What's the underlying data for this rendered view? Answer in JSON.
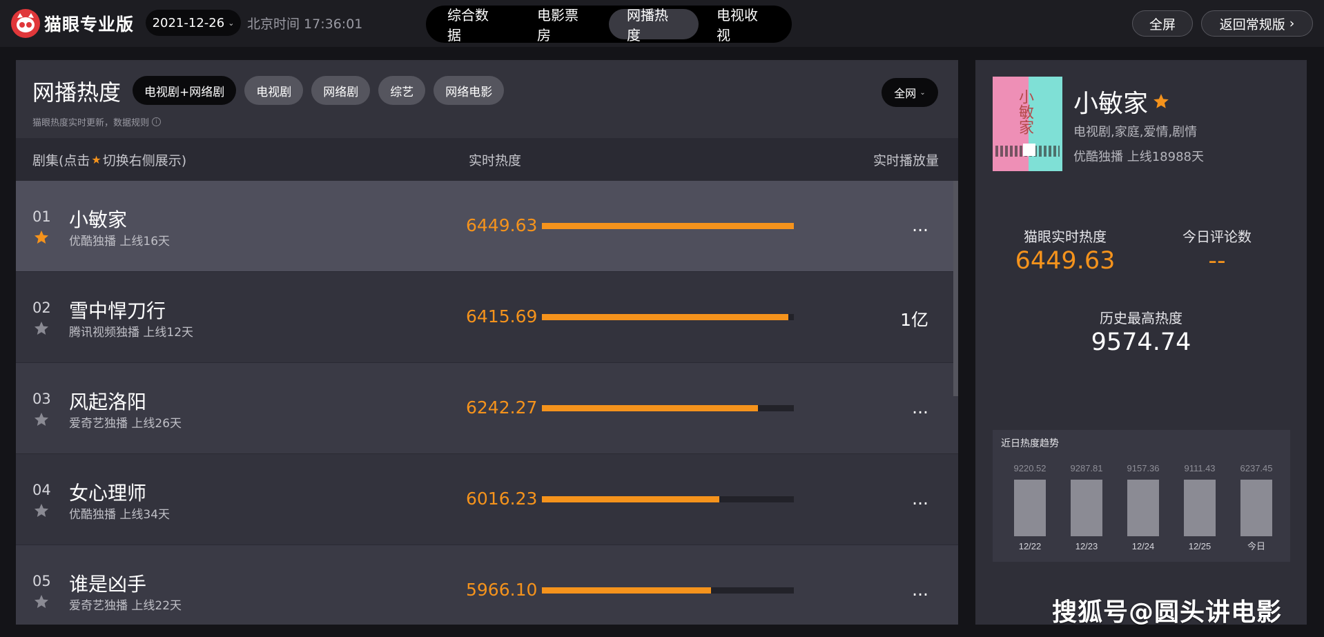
{
  "app": {
    "logo_text": "猫眼专业版",
    "date": "2021-12-26",
    "clock": "北京时间 17:36:01",
    "nav_tabs": [
      {
        "label": "综合数据",
        "active": false
      },
      {
        "label": "电影票房",
        "active": false
      },
      {
        "label": "网播热度",
        "active": true
      },
      {
        "label": "电视收视",
        "active": false
      }
    ],
    "fullscreen_label": "全屏",
    "back_label": "返回常规版",
    "back_icon": "chevron-right-icon"
  },
  "list_panel": {
    "title": "网播热度",
    "filters": [
      {
        "label": "电视剧+网络剧",
        "active": true
      },
      {
        "label": "电视剧",
        "active": false
      },
      {
        "label": "网络剧",
        "active": false
      },
      {
        "label": "综艺",
        "active": false
      },
      {
        "label": "网络电影",
        "active": false
      }
    ],
    "scope": "全网",
    "note": "猫眼热度实时更新，数据规则",
    "col_show_prefix": "剧集(点击",
    "col_show_suffix": "切换右侧展示)",
    "col_heat": "实时热度",
    "col_plays": "实时播放量",
    "accent_color": "#f5931c",
    "rows": [
      {
        "rank": "01",
        "title": "小敏家",
        "meta": "优酷独播  上线16天",
        "heat": "6449.63",
        "heat_value": 6449.63,
        "plays": "...",
        "starred": true
      },
      {
        "rank": "02",
        "title": "雪中悍刀行",
        "meta": "腾讯视频独播  上线12天",
        "heat": "6415.69",
        "heat_value": 6415.69,
        "plays": "1亿",
        "starred": false
      },
      {
        "rank": "03",
        "title": "风起洛阳",
        "meta": "爱奇艺独播  上线26天",
        "heat": "6242.27",
        "heat_value": 6242.27,
        "plays": "...",
        "starred": false
      },
      {
        "rank": "04",
        "title": "女心理师",
        "meta": "优酷独播  上线34天",
        "heat": "6016.23",
        "heat_value": 6016.23,
        "plays": "...",
        "starred": false
      },
      {
        "rank": "05",
        "title": "谁是凶手",
        "meta": "爱奇艺独播  上线22天",
        "heat": "5966.10",
        "heat_value": 5966.1,
        "plays": "...",
        "starred": false
      }
    ]
  },
  "detail": {
    "title": "小敏家",
    "poster_title": "小敏家",
    "genres": "电视剧,家庭,爱情,剧情",
    "info": "优酷独播  上线18988天",
    "stat_heat_label": "猫眼实时热度",
    "stat_heat_value": "6449.63",
    "stat_comments_label": "今日评论数",
    "stat_comments_value": "--",
    "stat_peak_label": "历史最高热度",
    "stat_peak_value": "9574.74",
    "trend_title": "近日热度趋势"
  },
  "chart_data": {
    "type": "bar",
    "title": "近日热度趋势",
    "categories": [
      "12/22",
      "12/23",
      "12/24",
      "12/25",
      "今日"
    ],
    "values": [
      9220.52,
      9287.81,
      9157.36,
      9111.43,
      6237.45
    ],
    "value_labels": [
      "9220.52",
      "9287.81",
      "9157.36",
      "9111.43",
      "6237.45"
    ],
    "bar_color": "#8b8b94"
  },
  "watermark": "搜狐号@圆头讲电影"
}
